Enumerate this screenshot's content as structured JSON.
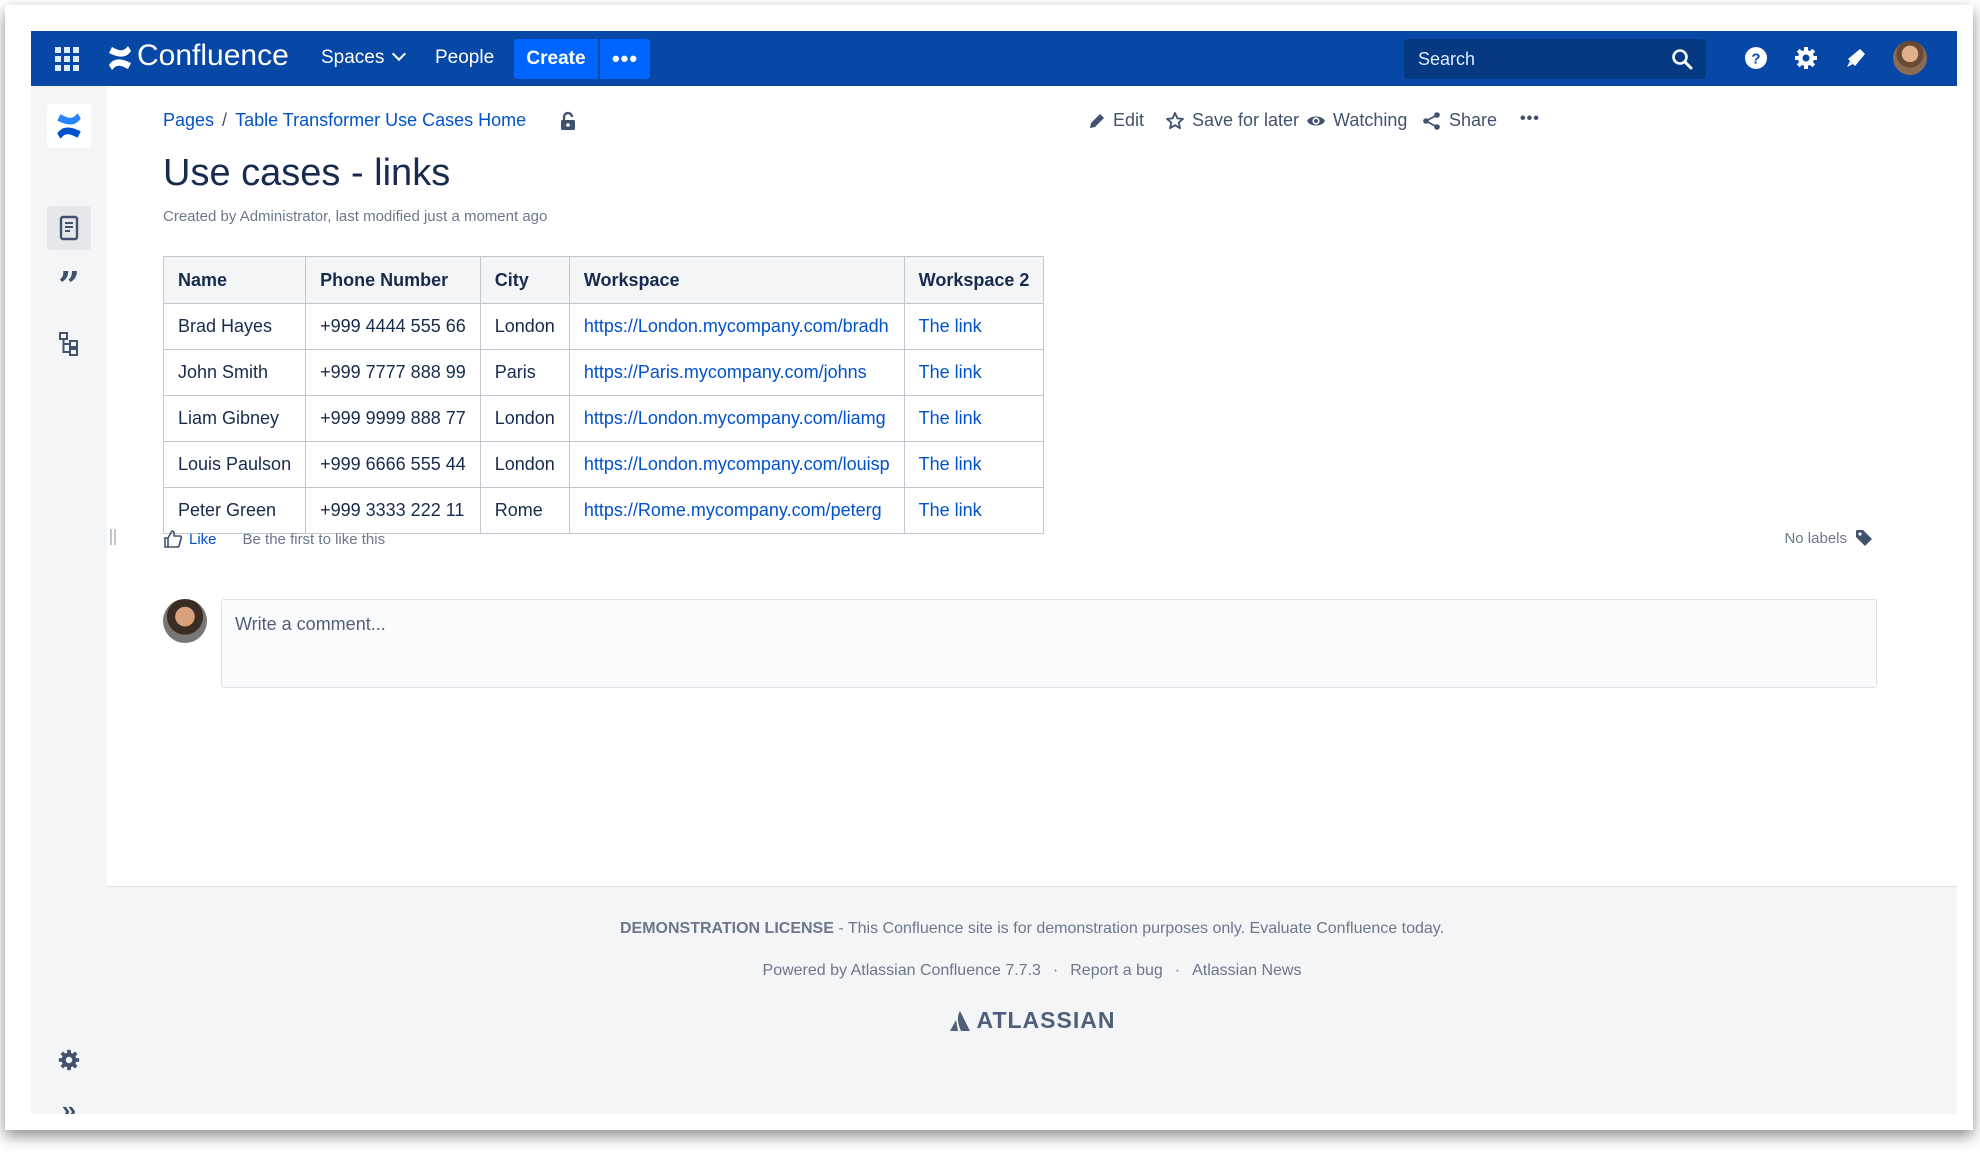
{
  "nav": {
    "logo_text": "Confluence",
    "spaces": "Spaces",
    "people": "People",
    "create": "Create",
    "more": "•••",
    "search_placeholder": "Search"
  },
  "breadcrumb": {
    "root": "Pages",
    "sep": "/",
    "parent": "Table Transformer Use Cases Home"
  },
  "actions": {
    "edit": "Edit",
    "save": "Save for later",
    "watching": "Watching",
    "share": "Share",
    "more": "•••"
  },
  "page": {
    "title": "Use cases - links",
    "byline": "Created by Administrator, last modified just a moment ago"
  },
  "table": {
    "headers": [
      "Name",
      "Phone Number",
      "City",
      "Workspace",
      "Workspace 2"
    ],
    "rows": [
      [
        "Brad Hayes",
        "+999 4444 555 66",
        "London",
        "https://London.mycompany.com/bradh",
        "The link"
      ],
      [
        "John Smith",
        "+999 7777 888 99",
        "Paris",
        "https://Paris.mycompany.com/johns",
        "The link"
      ],
      [
        "Liam Gibney",
        "+999 9999 888 77",
        "London",
        "https://London.mycompany.com/liamg",
        "The link"
      ],
      [
        "Louis Paulson",
        "+999 6666 555 44",
        "London",
        "https://London.mycompany.com/louisp",
        "The link"
      ],
      [
        "Peter Green",
        "+999 3333 222 11",
        "Rome",
        "https://Rome.mycompany.com/peterg",
        "The link"
      ]
    ]
  },
  "likes": {
    "like": "Like",
    "first": "Be the first to like this",
    "labels": "No labels"
  },
  "comment": {
    "placeholder": "Write a comment..."
  },
  "footer": {
    "license_bold": "DEMONSTRATION LICENSE",
    "license_text": " - This Confluence site is for demonstration purposes only. Evaluate Confluence today.",
    "powered": "Powered by Atlassian Confluence 7.7.3",
    "dot": "·",
    "report": "Report a bug",
    "news": "Atlassian News",
    "brand": "ATLASSIAN"
  },
  "colors": {
    "nav_bg": "#0747a6",
    "create_bg": "#0065ff",
    "link": "#0052cc"
  }
}
